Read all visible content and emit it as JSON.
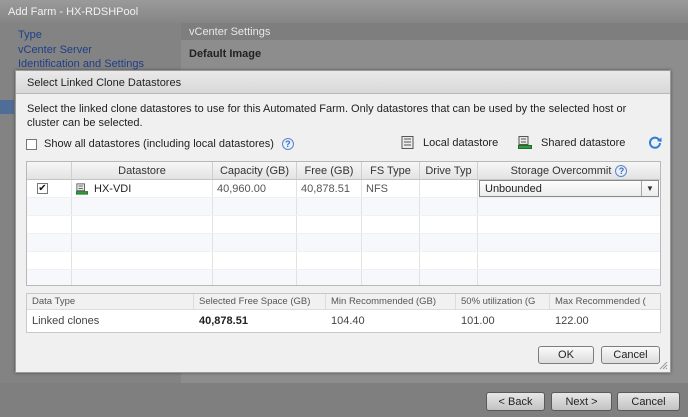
{
  "wizard": {
    "title": "Add Farm - HX-RDSHPool",
    "nav": [
      "Type",
      "vCenter Server",
      "Identification and Settings"
    ],
    "section_header": "vCenter Settings",
    "section_sub": "Default Image",
    "buttons": {
      "back": "< Back",
      "next": "Next >",
      "cancel": "Cancel"
    }
  },
  "dialog": {
    "title": "Select Linked Clone Datastores",
    "description": "Select the linked clone datastores to use for this Automated Farm. Only datastores that can be used by the selected host or cluster can be selected.",
    "show_all_label": "Show all datastores (including local datastores)",
    "legend": {
      "local": "Local datastore",
      "shared": "Shared datastore"
    },
    "table": {
      "columns": [
        "Datastore",
        "Capacity (GB)",
        "Free (GB)",
        "FS Type",
        "Drive Typ",
        "Storage Overcommit"
      ],
      "rows": [
        {
          "checked": true,
          "datastore": "HX-VDI",
          "capacity": "40,960.00",
          "free": "40,878.51",
          "fs_type": "NFS",
          "drive_type": "",
          "overcommit": "Unbounded"
        }
      ]
    },
    "summary": {
      "columns": [
        "Data Type",
        "Selected Free Space (GB)",
        "Min Recommended (GB)",
        "50% utilization (G",
        "Max Recommended ("
      ],
      "values": [
        "Linked clones",
        "40,878.51",
        "104.40",
        "101.00",
        "122.00"
      ]
    },
    "ok_label": "OK",
    "cancel_label": "Cancel",
    "check_glyph": "✔",
    "help_glyph": "?",
    "dropdown_glyph": "▼"
  }
}
